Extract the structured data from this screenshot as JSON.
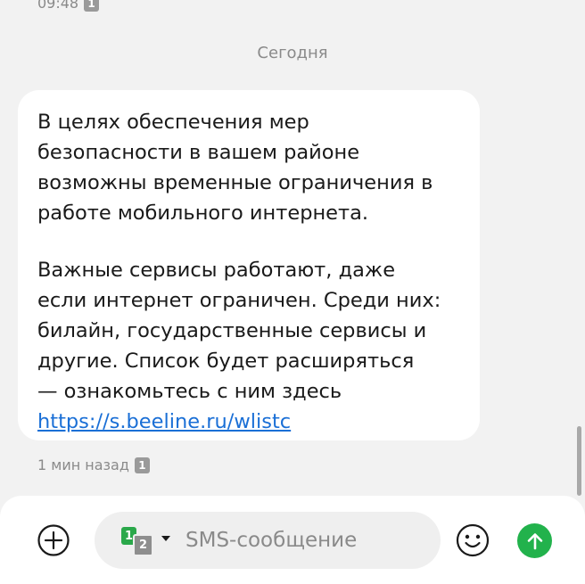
{
  "previous_message": {
    "time": "09:48",
    "sim": "1"
  },
  "date_separator": "Сегодня",
  "message": {
    "paragraph1": "В целях обеспечения мер\nбезопасности в вашем районе\nвозможны временные ограничения в\nработе мобильного интернета.",
    "paragraph2": "Важные сервисы работают, даже\nесли интернет ограничен. Среди них:\nбилайн, государственные сервисы и\nдругие. Список будет расширяться\n— ознакомьтесь с ним здесь",
    "link": "https://s.beeline.ru/wlistc",
    "meta_time": "1 мин назад",
    "meta_sim": "1"
  },
  "composer": {
    "sim_primary": "1",
    "sim_secondary": "2",
    "placeholder": "SMS-сообщение",
    "value": "",
    "icons": [
      "plus-circle-icon",
      "chevron-down-icon",
      "emoji-icon",
      "send-arrow-icon"
    ]
  },
  "colors": {
    "background": "#f2f2f2",
    "bubble": "#ffffff",
    "link": "#1a6fd6",
    "send_button": "#22b24c",
    "sim_primary": "#2aa84a",
    "sim_secondary": "#8e8e8e"
  }
}
